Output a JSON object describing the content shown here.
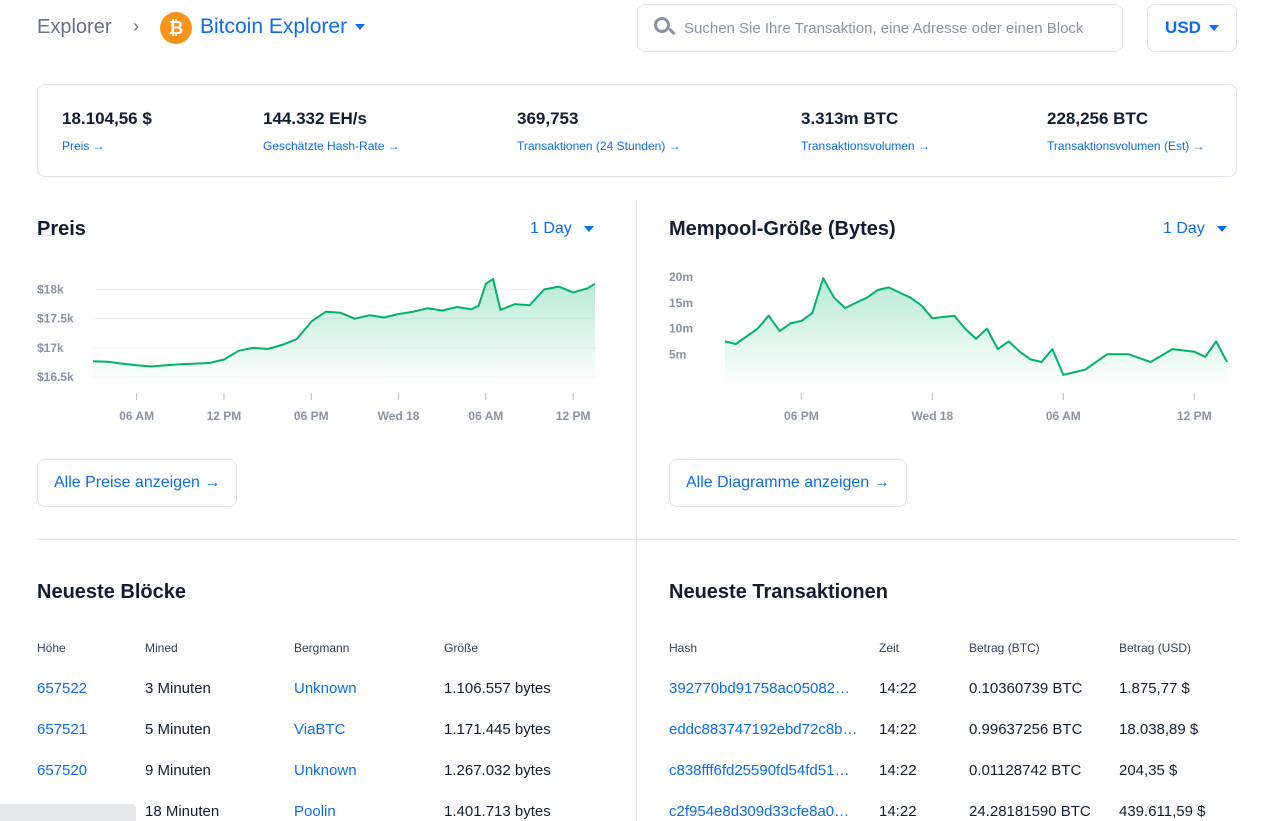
{
  "breadcrumb": {
    "root": "Explorer",
    "separator": "›",
    "current": "Bitcoin Explorer"
  },
  "search": {
    "placeholder": "Suchen Sie Ihre Transaktion, eine Adresse oder einen Block",
    "value": ""
  },
  "currency": {
    "selected": "USD"
  },
  "stats": [
    {
      "value": "18.104,56 $",
      "label": "Preis →"
    },
    {
      "value": "144.332 EH/s",
      "label": "Geschätzte Hash-Rate →"
    },
    {
      "value": "369,753",
      "label": "Transaktionen (24 Stunden) →"
    },
    {
      "value": "3.313m BTC",
      "label": "Transaktionsvolumen →"
    },
    {
      "value": "228,256 BTC",
      "label": "Transaktionsvolumen (Est) →"
    }
  ],
  "price_panel": {
    "title": "Preis",
    "range": "1 Day",
    "button": "Alle Preise anzeigen →"
  },
  "mempool_panel": {
    "title": "Mempool-Größe (Bytes)",
    "range": "1 Day",
    "button": "Alle Diagramme anzeigen →"
  },
  "chart_data": [
    {
      "type": "area",
      "title": "Preis",
      "xlabel": "",
      "ylabel": "",
      "y_tick_labels": [
        "$18k",
        "$17.5k",
        "$17k",
        "$16.5k"
      ],
      "y_ticks": [
        18000,
        17500,
        17000,
        16500
      ],
      "ylim": [
        16500,
        18300
      ],
      "x_tick_labels": [
        "06 AM",
        "12 PM",
        "06 PM",
        "Wed 18",
        "06 AM",
        "12 PM"
      ],
      "x_tick_positions": [
        2,
        8,
        14,
        20,
        26,
        32
      ],
      "xlim": [
        -1,
        33.5
      ],
      "grid": true,
      "color": "#00b26b",
      "series": [
        {
          "x": [
            -1,
            0,
            1,
            2,
            3,
            4,
            5,
            6,
            7,
            8,
            9,
            10,
            11,
            12,
            13,
            14,
            15,
            16,
            17,
            18,
            19,
            20,
            21,
            22,
            23,
            24,
            25,
            25.5,
            26,
            26.5,
            27,
            28,
            29,
            30,
            31,
            32,
            33,
            33.5
          ],
          "values": [
            16770,
            16760,
            16730,
            16700,
            16680,
            16700,
            16720,
            16730,
            16740,
            16800,
            16950,
            17000,
            16980,
            17050,
            17150,
            17450,
            17620,
            17600,
            17500,
            17560,
            17520,
            17580,
            17620,
            17680,
            17640,
            17700,
            17660,
            17720,
            18100,
            18180,
            17650,
            17750,
            17730,
            18000,
            18050,
            17950,
            18020,
            18100
          ]
        }
      ]
    },
    {
      "type": "area",
      "title": "Mempool-Größe (Bytes)",
      "xlabel": "",
      "ylabel": "",
      "y_tick_labels": [
        "20m",
        "15m",
        "10m",
        "5m"
      ],
      "y_ticks": [
        20,
        15,
        10,
        5
      ],
      "ylim": [
        0,
        21
      ],
      "x_tick_labels": [
        "06 PM",
        "Wed 18",
        "06 AM",
        "12 PM"
      ],
      "x_tick_positions": [
        2,
        8,
        14,
        20
      ],
      "xlim": [
        -1.5,
        21.5
      ],
      "grid": false,
      "color": "#00b26b",
      "series": [
        {
          "x": [
            -1.5,
            -1,
            0,
            0.5,
            1,
            1.5,
            2,
            2.5,
            3,
            3.5,
            4,
            5,
            5.5,
            6,
            6.5,
            7,
            7.5,
            8,
            9,
            9.5,
            10,
            10.5,
            11,
            11.5,
            12,
            12.5,
            13,
            13.5,
            14,
            15,
            16,
            17,
            18,
            19,
            20,
            20.5,
            21,
            21.5
          ],
          "values": [
            7.5,
            7,
            10,
            12.5,
            9.5,
            11,
            11.5,
            13,
            19.8,
            16,
            14,
            16,
            17.5,
            18,
            17,
            16,
            14.5,
            12,
            12.5,
            10,
            8,
            10,
            6,
            7.5,
            5.5,
            4,
            3.5,
            6,
            1,
            2,
            5,
            5,
            3.5,
            6,
            5.5,
            4.5,
            7.5,
            3.5
          ]
        }
      ]
    }
  ],
  "blocks": {
    "title": "Neueste Blöcke",
    "columns": [
      "Höhe",
      "Mined",
      "Bergmann",
      "Größe"
    ],
    "rows": [
      {
        "height": "657522",
        "mined": "3 Minuten",
        "miner": "Unknown",
        "size": "1.106.557 bytes"
      },
      {
        "height": "657521",
        "mined": "5 Minuten",
        "miner": "ViaBTC",
        "size": "1.171.445 bytes"
      },
      {
        "height": "657520",
        "mined": "9 Minuten",
        "miner": "Unknown",
        "size": "1.267.032 bytes"
      },
      {
        "height": "",
        "mined": "18 Minuten",
        "miner": "Poolin",
        "size": "1.401.713 bytes"
      }
    ]
  },
  "transactions": {
    "title": "Neueste Transaktionen",
    "columns": [
      "Hash",
      "Zeit",
      "Betrag (BTC)",
      "Betrag (USD)"
    ],
    "rows": [
      {
        "hash": "392770bd91758ac05082…",
        "time": "14:22",
        "btc": "0.10360739 BTC",
        "usd": "1.875,77 $"
      },
      {
        "hash": "eddc883747192ebd72c8b…",
        "time": "14:22",
        "btc": "0.99637256 BTC",
        "usd": "18.038,89 $"
      },
      {
        "hash": "c838fff6fd25590fd54fd51…",
        "time": "14:22",
        "btc": "0.01128742 BTC",
        "usd": "204,35 $"
      },
      {
        "hash": "c2f954e8d309d33cfe8a0…",
        "time": "14:22",
        "btc": "24.28181590 BTC",
        "usd": "439.611,59 $"
      }
    ]
  }
}
